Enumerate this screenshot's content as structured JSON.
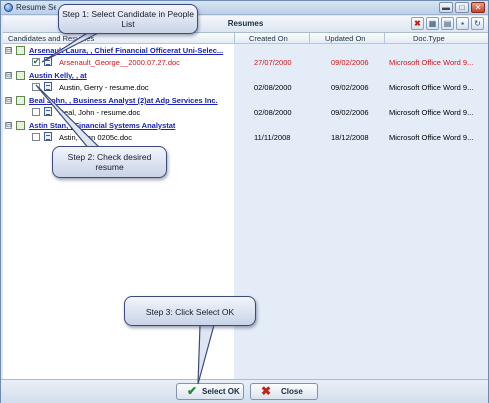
{
  "window": {
    "title": "Resume Sel",
    "minimize_glyph": "▬",
    "maximize_glyph": "□",
    "close_glyph": "✕"
  },
  "panel": {
    "title": "Resumes",
    "toolbar": [
      {
        "icon": "delete-icon",
        "glyph": "✖"
      },
      {
        "icon": "grid-icon",
        "glyph": "▦"
      },
      {
        "icon": "print-icon",
        "glyph": "▤"
      },
      {
        "icon": "save-icon",
        "glyph": "▪"
      },
      {
        "icon": "refresh-icon",
        "glyph": "↻"
      }
    ]
  },
  "columns": {
    "candidates": "Candidates and Resumes",
    "created": "Created On",
    "updated": "Updated On",
    "doctype": "Doc.Type"
  },
  "candidates": [
    {
      "name": "Arsenault Laura, , Chief Financial Officerat Uni-Selec...",
      "expander": "⊟",
      "resume": {
        "file": "Arsenault_George__2000.07.27.doc",
        "created": "27/07/2000",
        "updated": "09/02/2006",
        "doctype": "Microsoft Office Word 9...",
        "checked": true,
        "highlight": true
      }
    },
    {
      "name": "Austin Kelly, , at",
      "expander": "⊟",
      "resume": {
        "file": "Austin, Gerry - resume.doc",
        "created": "02/08/2000",
        "updated": "09/02/2006",
        "doctype": "Microsoft Office Word 9...",
        "checked": false,
        "highlight": false
      }
    },
    {
      "name": "Beal John, , Business Analyst (2)at Adp Services Inc.",
      "expander": "⊟",
      "resume": {
        "file": "Beal, John - resume.doc",
        "created": "02/08/2000",
        "updated": "09/02/2006",
        "doctype": "Microsoft Office Word 9...",
        "checked": false,
        "highlight": false
      }
    },
    {
      "name": "Astin Stan, , Financial Systems Analystat",
      "expander": "⊟",
      "resume": {
        "file": "Astin, Stan 0205c.doc",
        "created": "11/11/2008",
        "updated": "18/12/2008",
        "doctype": "Microsoft Office Word 9...",
        "checked": false,
        "highlight": false
      }
    }
  ],
  "buttons": {
    "select_ok": "Select OK",
    "close": "Close",
    "ok_glyph": "✔",
    "close_glyph": "✖"
  },
  "callouts": {
    "step1": "Step 1: Select Candidate in People List",
    "step2": "Step 2: Check desired resume",
    "step3": "Step 3: Click Select OK"
  },
  "colors": {
    "highlight_text": "#d6141a",
    "link": "#1a22b8",
    "column_blue": "#e3ecf7"
  }
}
